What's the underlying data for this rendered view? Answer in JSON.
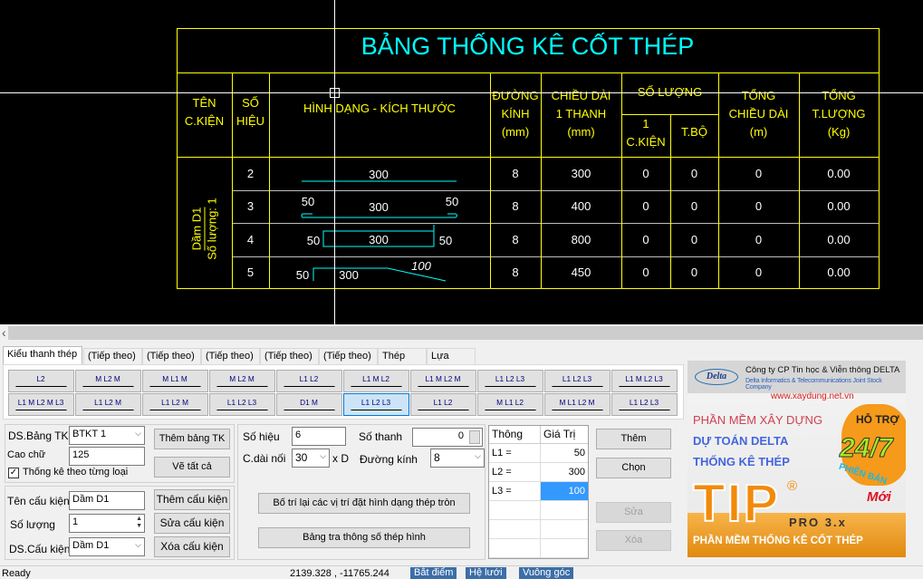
{
  "table": {
    "title": "BẢNG THỐNG KÊ CỐT THÉP",
    "headers": {
      "ten": "TÊN\nC.KIỆN",
      "so_hieu": "SỐ\nHIỆU",
      "hinh_dang": "HÌNH DẠNG - KÍCH THƯỚC",
      "duong_kinh": "ĐƯỜNG\nKÍNH\n(mm)",
      "chieu_dai": "CHIỀU DÀI\n1 THANH\n(mm)",
      "so_luong": "SỐ LƯỢNG",
      "sl_1ck": "1\nC.KIỆN",
      "sl_tbo": "T.BỘ",
      "tong_cd": "TỔNG\nCHIỀU DÀI\n(m)",
      "tong_tl": "TỔNG\nT.LƯỢNG\n(Kg)"
    },
    "component_name": "Dầm D1",
    "component_qty": "Số lượng: 1",
    "rows": [
      {
        "so_hieu": "2",
        "dims": [
          "300"
        ],
        "dk": "8",
        "cd": "300",
        "ck": "0",
        "tb": "0",
        "tcd": "0",
        "ttl": "0.00"
      },
      {
        "so_hieu": "3",
        "dims": [
          "50",
          "300",
          "50"
        ],
        "dk": "8",
        "cd": "400",
        "ck": "0",
        "tb": "0",
        "tcd": "0",
        "ttl": "0.00"
      },
      {
        "so_hieu": "4",
        "dims": [
          "50",
          "300",
          "50"
        ],
        "dk": "8",
        "cd": "800",
        "ck": "0",
        "tb": "0",
        "tcd": "0",
        "ttl": "0.00"
      },
      {
        "so_hieu": "5",
        "dims": [
          "50",
          "300",
          "100"
        ],
        "dk": "8",
        "cd": "450",
        "ck": "0",
        "tb": "0",
        "tcd": "0",
        "ttl": "0.00"
      }
    ],
    "line_color": "#ffff00",
    "shape_color": "#00ffff"
  },
  "scroll_left": "‹",
  "tabs": [
    "Kiểu thanh thép",
    "(Tiếp theo)",
    "(Tiếp theo)",
    "(Tiếp theo)",
    "(Tiếp theo)",
    "(Tiếp theo)",
    "Thép hình",
    "Lựa chọn"
  ],
  "shapes": [
    {
      "icon": "straight-bar-icon",
      "label": "L2"
    },
    {
      "icon": "hook-both-icon",
      "label": "M  L2  M"
    },
    {
      "icon": "hook-both-up-icon",
      "label": "M  L1  M"
    },
    {
      "icon": "hook-ends-icon",
      "label": "M  L2  M"
    },
    {
      "icon": "l-bend-icon",
      "label": "L1   L2"
    },
    {
      "icon": "l-bend-hook-icon",
      "label": "L1 M  L2"
    },
    {
      "icon": "u-hook-icon",
      "label": "L1 M L2 M"
    },
    {
      "icon": "u-bar-icon",
      "label": "L1  L2  L3"
    },
    {
      "icon": "u-bar-2-icon",
      "label": "L1  L2  L3"
    },
    {
      "icon": "u-hook-2-icon",
      "label": "L1 M L2 L3"
    },
    {
      "icon": "u-hook-3-icon",
      "label": "L1 M L2 M L3"
    },
    {
      "icon": "stirrup-icon",
      "label": "L1  L2  M"
    },
    {
      "icon": "stirrup-2-icon",
      "label": "L1  L2  M"
    },
    {
      "icon": "stirrup-3-icon",
      "label": "L1  L2  L3"
    },
    {
      "icon": "circle-icon",
      "label": "D1   M"
    },
    {
      "icon": "bent-bar-icon",
      "label": "L1  L2  L3"
    },
    {
      "icon": "bent-start-icon",
      "label": "L1   L2"
    },
    {
      "icon": "bent-hook-icon",
      "label": "M L1  L2"
    },
    {
      "icon": "bent-hook-2-icon",
      "label": "M L1 L2 M"
    },
    {
      "icon": "crank-bar-icon",
      "label": "L1 L2 L3"
    }
  ],
  "selected_shape": 15,
  "form": {
    "ds_bang_label": "DS.Bảng TK",
    "ds_bang_value": "BTKT 1",
    "cao_chu_label": "Cao chữ",
    "cao_chu_value": "125",
    "thong_ke_label": "Thống kê theo từng loại",
    "thong_ke_checked": true,
    "them_bang_btn": "Thêm bảng TK",
    "ve_tat_ca_btn": "Vẽ tất cả",
    "ten_ck_label": "Tên cấu kiện",
    "ten_ck_value": "Dầm D1",
    "so_luong_label": "Số lượng",
    "so_luong_value": "1",
    "ds_ck_label": "DS.Cấu kiện",
    "ds_ck_value": "Dầm D1",
    "them_ck_btn": "Thêm cấu kiện",
    "sua_ck_btn": "Sửa cấu kiện",
    "xoa_ck_btn": "Xóa cấu kiện",
    "so_hieu_label": "Số hiệu",
    "so_hieu_value": "6",
    "so_thanh_label": "Số thanh",
    "so_thanh_value": "0",
    "cdai_noi_label": "C.dài nối",
    "cdai_noi_value": "30",
    "xd_label": "x D",
    "duong_kinh_label": "Đường kính",
    "duong_kinh_value": "8",
    "bo_tri_btn": "Bố trí lại các vị trí đặt hình dạng thép tròn",
    "bang_tra_btn": "Bảng tra thông số thép hình"
  },
  "params": {
    "headers": [
      "Thông",
      "Giá Trị"
    ],
    "rows": [
      {
        "k": "L1 =",
        "v": "50"
      },
      {
        "k": "L2 =",
        "v": "300"
      },
      {
        "k": "L3 =",
        "v": "100"
      }
    ]
  },
  "actions": {
    "them": "Thêm",
    "chon": "Chọn",
    "sua": "Sửa",
    "xoa": "Xóa"
  },
  "ad": {
    "company": "Công ty CP Tin học & Viễn thông DELTA",
    "company_en": "Delta Informatics & Telecommunications Joint Stock Company",
    "logo": "Delta",
    "url": "www.xaydung.net.vn",
    "line1": "PHẦN MỀM XÂY DỰNG",
    "line2": "DỰ TOÁN DELTA",
    "line3": "THỐNG KÊ THÉP",
    "brand": "TIP",
    "reg": "®",
    "version": "PRO 3.x",
    "support": "HỖ TRỢ",
    "hours": "24/7",
    "new1": "PHIÊN BẢN",
    "new2": "Mới",
    "footer": "PHẦN MỀM THỐNG KÊ CỐT THÉP"
  },
  "status": {
    "text": "Ready",
    "coords": "2139.328 , -11765.244",
    "buttons": [
      "Bắt điểm",
      "Hệ lưới",
      "Vuông góc"
    ]
  }
}
